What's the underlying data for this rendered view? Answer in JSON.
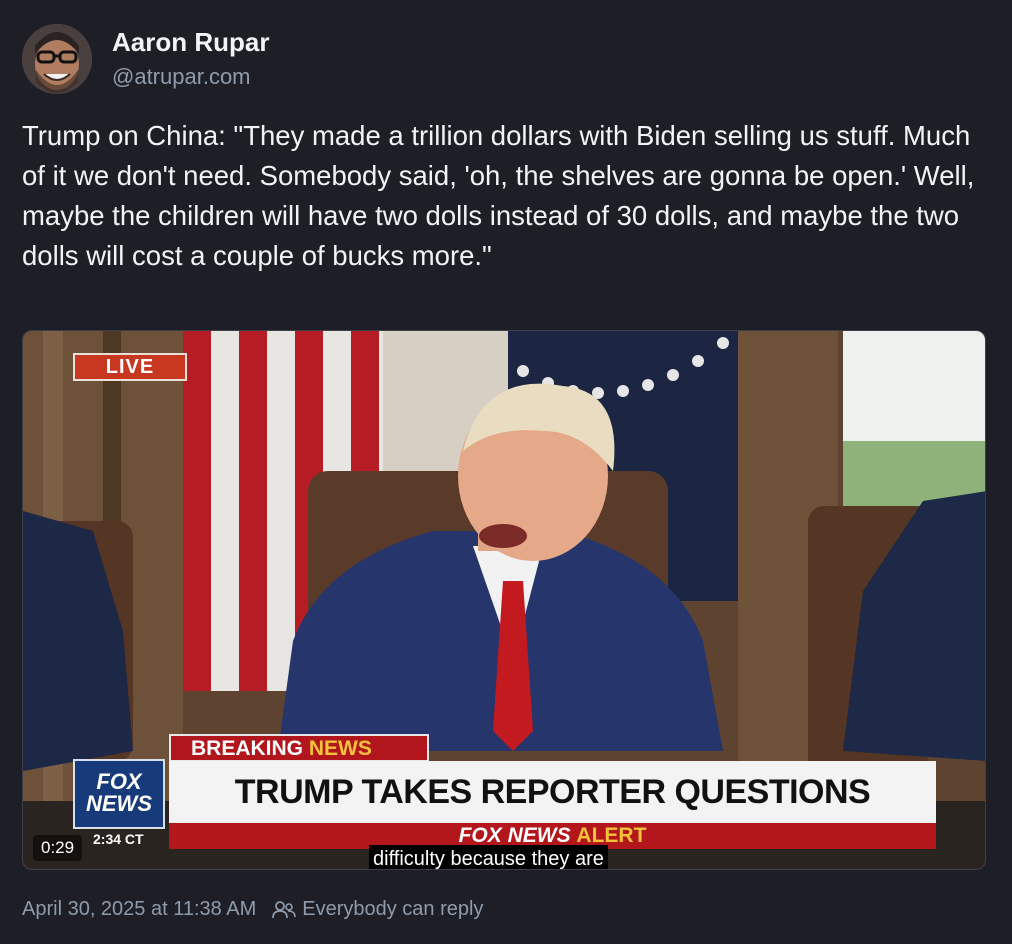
{
  "author": {
    "display_name": "Aaron Rupar",
    "handle": "@atrupar.com"
  },
  "post": {
    "text": "Trump on China: \"They made a trillion dollars with Biden selling us stuff. Much of it we don't need. Somebody said, 'oh, the shelves are gonna be open.' Well, maybe the children will have two dolls instead of 30 dolls, and maybe the two dolls will cost a couple of bucks more.\""
  },
  "video": {
    "live_badge": "LIVE",
    "breaking_prefix": "BREAKING ",
    "breaking_suffix": "NEWS",
    "headline": "TRUMP TAKES REPORTER QUESTIONS",
    "alert_prefix": "FOX NEWS ",
    "alert_suffix": "ALERT",
    "logo_line1": "FOX",
    "logo_line2": "NEWS",
    "clock": "2:34 CT",
    "time": "0:29",
    "caption": "difficulty because they are"
  },
  "footer": {
    "posted_at": "April 30, 2025 at 11:38 AM",
    "reply_setting": "Everybody can reply",
    "reply_icon": "people-icon"
  },
  "colors": {
    "background": "#1e1f26",
    "muted_text": "#8f9bab",
    "fox_red": "#b3161b",
    "fox_blue": "#173a7a"
  }
}
